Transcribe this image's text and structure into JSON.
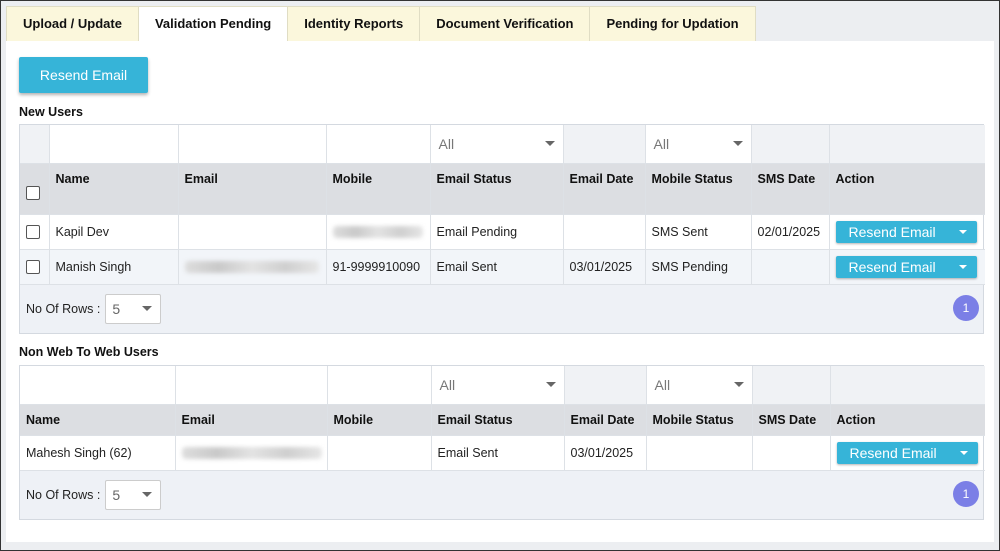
{
  "tabs": [
    "Upload / Update",
    "Validation Pending",
    "Identity Reports",
    "Document Verification",
    "Pending for Updation"
  ],
  "active_tab": "Validation Pending",
  "resend_email_label": "Resend Email",
  "new_users": {
    "title": "New Users",
    "filter_all": "All",
    "columns": [
      "Name",
      "Email",
      "Mobile",
      "Email Status",
      "Email Date",
      "Mobile Status",
      "SMS Date",
      "Action"
    ],
    "rows": [
      {
        "name": "Kapil Dev",
        "email": "",
        "mobile": "",
        "email_status": "Email Pending",
        "email_date": "",
        "mobile_status": "SMS Sent",
        "sms_date": "02/01/2025",
        "action": "Resend Email"
      },
      {
        "name": "Manish Singh",
        "email": "",
        "mobile": "91-9999910090",
        "email_status": "Email Sent",
        "email_date": "03/01/2025",
        "mobile_status": "SMS Pending",
        "sms_date": "",
        "action": "Resend Email"
      }
    ],
    "rows_label": "No Of Rows :",
    "rows_value": "5",
    "page": "1"
  },
  "non_web_users": {
    "title": "Non Web To Web Users",
    "filter_all": "All",
    "columns": [
      "Name",
      "Email",
      "Mobile",
      "Email Status",
      "Email Date",
      "Mobile Status",
      "SMS Date",
      "Action"
    ],
    "rows": [
      {
        "name": "Mahesh Singh (62)",
        "email": "",
        "mobile": "",
        "email_status": "Email Sent",
        "email_date": "03/01/2025",
        "mobile_status": "",
        "sms_date": "",
        "action": "Resend Email"
      }
    ],
    "rows_label": "No Of Rows :",
    "rows_value": "5",
    "page": "1"
  },
  "icons": {
    "dropdown": "chevron-down-icon",
    "checkbox": "checkbox-icon"
  },
  "colors": {
    "primary": "#36b4d8",
    "pagination": "#7b7fe6",
    "tab_bg": "#fbf7dc"
  }
}
